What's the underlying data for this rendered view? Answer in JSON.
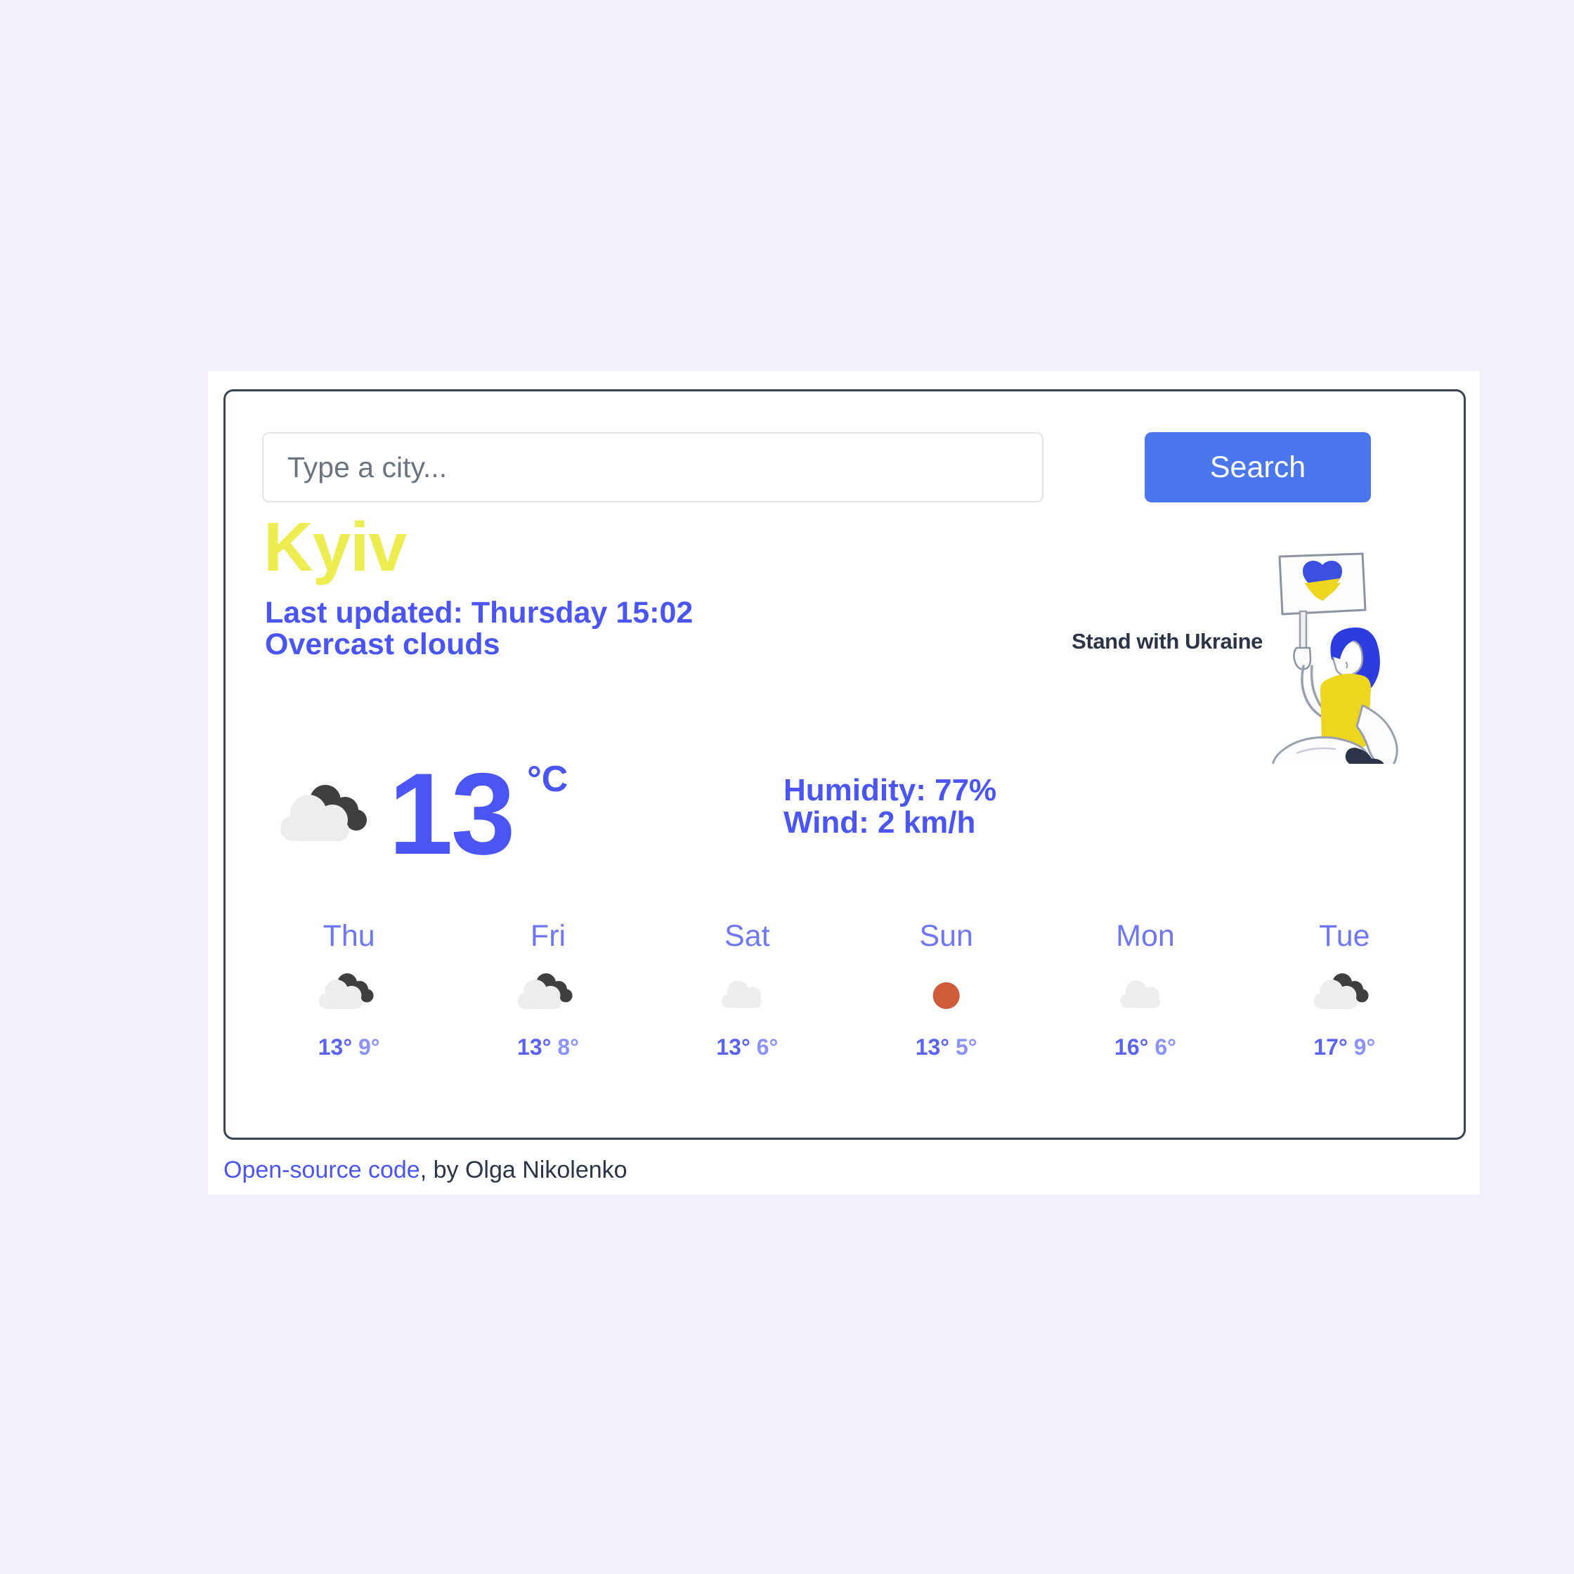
{
  "search": {
    "placeholder": "Type a city...",
    "value": "",
    "button_label": "Search"
  },
  "current": {
    "city": "Kyiv",
    "last_updated": "Last updated: Thursday 15:02",
    "condition": "Overcast clouds",
    "temperature": "13",
    "unit": "°C",
    "icon": "broken-clouds-icon",
    "humidity": "Humidity: 77%",
    "wind": "Wind: 2 km/h"
  },
  "banner": {
    "text": "Stand with Ukraine",
    "illustration": "person-holding-ukraine-heart-sign-illustration"
  },
  "forecast": [
    {
      "day": "Thu",
      "icon": "broken-clouds-icon",
      "max": "13°",
      "min": "9°"
    },
    {
      "day": "Fri",
      "icon": "broken-clouds-icon",
      "max": "13°",
      "min": "8°"
    },
    {
      "day": "Sat",
      "icon": "overcast-clouds-icon",
      "max": "13°",
      "min": "6°"
    },
    {
      "day": "Sun",
      "icon": "clear-sun-icon",
      "max": "13°",
      "min": "5°"
    },
    {
      "day": "Mon",
      "icon": "overcast-clouds-icon",
      "max": "16°",
      "min": "6°"
    },
    {
      "day": "Tue",
      "icon": "broken-clouds-icon",
      "max": "17°",
      "min": "9°"
    }
  ],
  "footer": {
    "link_label": "Open-source code",
    "author_text": ", by Olga Nikolenko"
  },
  "colors": {
    "page_background": "#f3efFb",
    "accent_blue": "#4a77ee",
    "text_blue": "#4b55f3",
    "city_yellow": "#eded52",
    "card_border": "#3c4257",
    "sun_orange": "#cf5b3a",
    "cloud_light": "#ededed",
    "cloud_dark": "#3f3f3f"
  }
}
